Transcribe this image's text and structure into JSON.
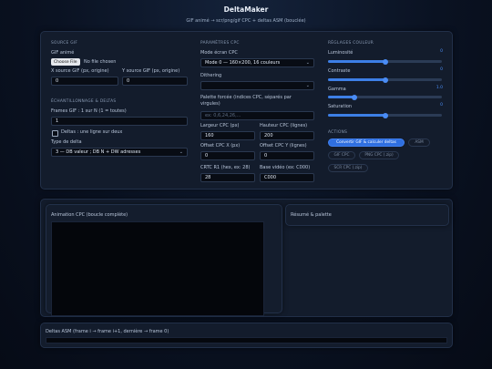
{
  "header": {
    "title": "DeltaMaker",
    "subtitle": "GIF animé → scr/png/gif CPC + deltas ASM (bouclée)"
  },
  "source": {
    "section": "SOURCE GIF",
    "gif_label": "GIF animé",
    "file_button": "Choose File",
    "file_status": "No file chosen",
    "x_label": "X source GIF (px, origine)",
    "x_value": "0",
    "y_label": "Y source GIF (px, origine)",
    "y_value": "0"
  },
  "sampling": {
    "section": "ÉCHANTILLONNAGE & DELTAS",
    "frames_label": "Frames GIF : 1 sur N (1 = toutes)",
    "frames_value": "1",
    "deltas_label": "Deltas : une ligne sur deux",
    "delta_type_label": "Type de delta",
    "delta_type_value": "3 — DB valeur ; DB N + DW adresses"
  },
  "params": {
    "section": "PARAMÈTRES CPC",
    "mode_label": "Mode écran CPC",
    "mode_value": "Mode 0 — 160×200, 16 couleurs",
    "dither_label": "Dithering",
    "dither_value": "",
    "palette_label": "Palette forcée (indices CPC, séparés par virgules)",
    "palette_placeholder": "ex: 0,6,24,26,...",
    "width_label": "Largeur CPC (px)",
    "width_value": "160",
    "height_label": "Hauteur CPC (lignes)",
    "height_value": "200",
    "offx_label": "Offset CPC X (px)",
    "offx_value": "0",
    "offy_label": "Offset CPC Y (lignes)",
    "offy_value": "0",
    "crtc_label": "CRTC R1 (hex, ex: 28)",
    "crtc_value": "28",
    "base_label": "Base vidéo (ex: C000)",
    "base_value": "C000"
  },
  "color": {
    "section": "RÉGLAGES COULEUR",
    "sliders": [
      {
        "label": "Luminosité",
        "value": "0",
        "fraction": 0.5
      },
      {
        "label": "Contraste",
        "value": "0",
        "fraction": 0.5
      },
      {
        "label": "Gamma",
        "value": "1.0",
        "fraction": 0.23
      },
      {
        "label": "Saturation",
        "value": "0",
        "fraction": 0.5
      }
    ]
  },
  "actions": {
    "section": "ACTIONS",
    "convert": "Convertir GIF & calculer deltas",
    "asm": "ASM",
    "gif": "GIF CPC",
    "png": "PNG CPC (.zip)",
    "scr": "SCR CPC (.zip)"
  },
  "animation": {
    "title": "Animation CPC (boucle complète)"
  },
  "summary": {
    "title": "Résumé & palette"
  },
  "deltas_asm": {
    "title": "Deltas ASM (frame i → frame i+1, dernière → frame 0)"
  },
  "colors": {
    "accent": "#3d7fe6",
    "background": "#0a1222",
    "card": "#131c2c"
  }
}
